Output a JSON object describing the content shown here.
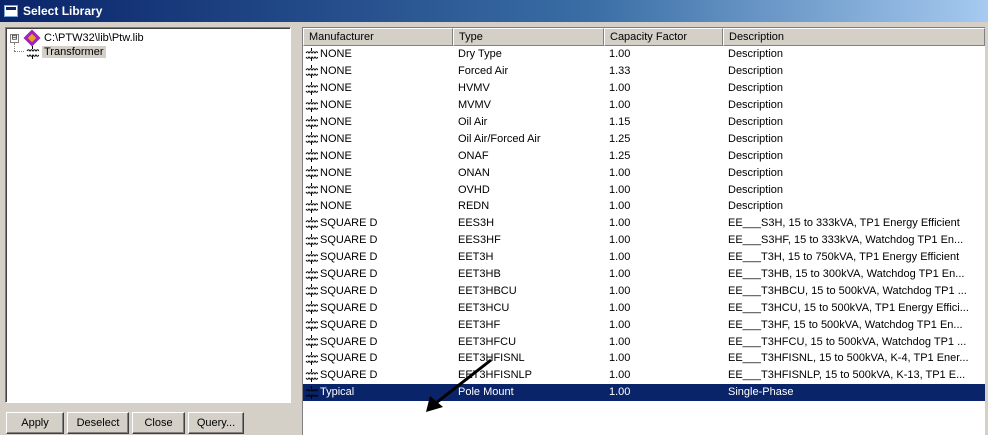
{
  "window": {
    "title": "Select Library"
  },
  "tree": {
    "expander": "⊟",
    "root_label": "C:\\PTW32\\lib\\Ptw.lib",
    "child_label": "Transformer"
  },
  "buttons": {
    "apply": "Apply",
    "deselect": "Deselect",
    "close": "Close",
    "query": "Query..."
  },
  "grid": {
    "columns": [
      "Manufacturer",
      "Type",
      "Capacity Factor",
      "Description"
    ],
    "rows": [
      {
        "manufacturer": "NONE",
        "type": "Dry Type",
        "capacity": "1.00",
        "description": "Description"
      },
      {
        "manufacturer": "NONE",
        "type": "Forced Air",
        "capacity": "1.33",
        "description": "Description"
      },
      {
        "manufacturer": "NONE",
        "type": "HVMV",
        "capacity": "1.00",
        "description": "Description"
      },
      {
        "manufacturer": "NONE",
        "type": "MVMV",
        "capacity": "1.00",
        "description": "Description"
      },
      {
        "manufacturer": "NONE",
        "type": "Oil Air",
        "capacity": "1.15",
        "description": "Description"
      },
      {
        "manufacturer": "NONE",
        "type": "Oil Air/Forced Air",
        "capacity": "1.25",
        "description": "Description"
      },
      {
        "manufacturer": "NONE",
        "type": "ONAF",
        "capacity": "1.25",
        "description": "Description"
      },
      {
        "manufacturer": "NONE",
        "type": "ONAN",
        "capacity": "1.00",
        "description": "Description"
      },
      {
        "manufacturer": "NONE",
        "type": "OVHD",
        "capacity": "1.00",
        "description": "Description"
      },
      {
        "manufacturer": "NONE",
        "type": "REDN",
        "capacity": "1.00",
        "description": "Description"
      },
      {
        "manufacturer": "SQUARE D",
        "type": "EES3H",
        "capacity": "1.00",
        "description": "EE___S3H, 15 to 333kVA, TP1 Energy Efficient"
      },
      {
        "manufacturer": "SQUARE D",
        "type": "EES3HF",
        "capacity": "1.00",
        "description": "EE___S3HF, 15 to 333kVA, Watchdog TP1 En..."
      },
      {
        "manufacturer": "SQUARE D",
        "type": "EET3H",
        "capacity": "1.00",
        "description": "EE___T3H, 15 to 750kVA, TP1 Energy Efficient"
      },
      {
        "manufacturer": "SQUARE D",
        "type": "EET3HB",
        "capacity": "1.00",
        "description": "EE___T3HB, 15 to 300kVA, Watchdog TP1 En..."
      },
      {
        "manufacturer": "SQUARE D",
        "type": "EET3HBCU",
        "capacity": "1.00",
        "description": "EE___T3HBCU, 15 to 500kVA, Watchdog TP1 ..."
      },
      {
        "manufacturer": "SQUARE D",
        "type": "EET3HCU",
        "capacity": "1.00",
        "description": "EE___T3HCU, 15 to 500kVA, TP1 Energy Effici..."
      },
      {
        "manufacturer": "SQUARE D",
        "type": "EET3HF",
        "capacity": "1.00",
        "description": "EE___T3HF, 15 to 500kVA, Watchdog TP1 En..."
      },
      {
        "manufacturer": "SQUARE D",
        "type": "EET3HFCU",
        "capacity": "1.00",
        "description": "EE___T3HFCU, 15 to 500kVA, Watchdog TP1 ..."
      },
      {
        "manufacturer": "SQUARE D",
        "type": "EET3HFISNL",
        "capacity": "1.00",
        "description": "EE___T3HFISNL, 15 to 500kVA, K-4, TP1 Ener..."
      },
      {
        "manufacturer": "SQUARE D",
        "type": "EET3HFISNLP",
        "capacity": "1.00",
        "description": "EE___T3HFISNLP, 15 to 500kVA, K-13, TP1 E..."
      },
      {
        "manufacturer": "Typical",
        "type": "Pole Mount",
        "capacity": "1.00",
        "description": "Single-Phase",
        "selected": true
      }
    ]
  },
  "icons": {
    "row_icon": "transformer-icon",
    "tree_root_icon": "library-icon"
  },
  "colors": {
    "selection": "#0a246a",
    "titlebar": "#0a246a",
    "dialog_bg": "#d4d0c8"
  }
}
